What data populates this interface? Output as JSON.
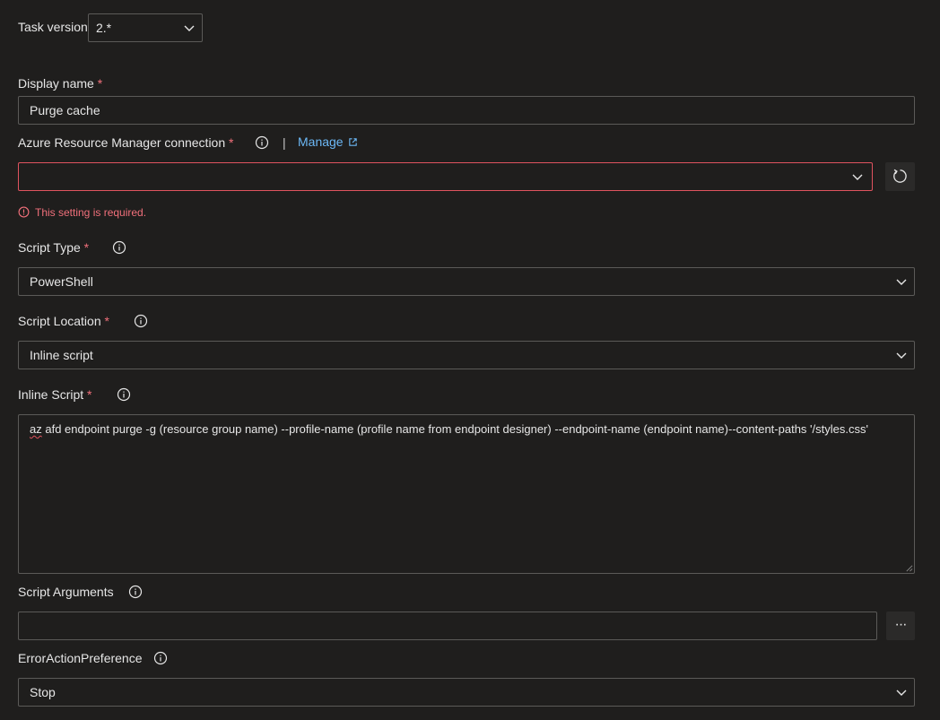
{
  "task_version": {
    "label": "Task version",
    "value": "2.*"
  },
  "display_name": {
    "label": "Display name",
    "required_mark": "*",
    "value": "Purge cache"
  },
  "arm_connection": {
    "label": "Azure Resource Manager connection",
    "required_mark": "*",
    "separator": "|",
    "manage_label": "Manage",
    "value": "",
    "error_message": "This setting is required."
  },
  "script_type": {
    "label": "Script Type",
    "required_mark": "*",
    "value": "PowerShell"
  },
  "script_location": {
    "label": "Script Location",
    "required_mark": "*",
    "value": "Inline script"
  },
  "inline_script": {
    "label": "Inline Script",
    "required_mark": "*",
    "first_word": "az",
    "second_word": "afd",
    "rest": " endpoint purge -g (resource group name) --profile-name (profile name from endpoint designer) --endpoint-name (endpoint name)--content-paths '/styles.css'"
  },
  "script_arguments": {
    "label": "Script Arguments",
    "value": "",
    "more_button": "···"
  },
  "error_action_preference": {
    "label": "ErrorActionPreference",
    "value": "Stop"
  },
  "icons": {
    "info": "info-icon",
    "chevron": "chevron-down-icon",
    "refresh": "refresh-icon",
    "external_link": "external-link-icon",
    "error": "error-circle-icon"
  },
  "colors": {
    "background": "#1f1e1d",
    "border": "#5b5a58",
    "error": "#f1707b",
    "link": "#6cb8f6"
  }
}
